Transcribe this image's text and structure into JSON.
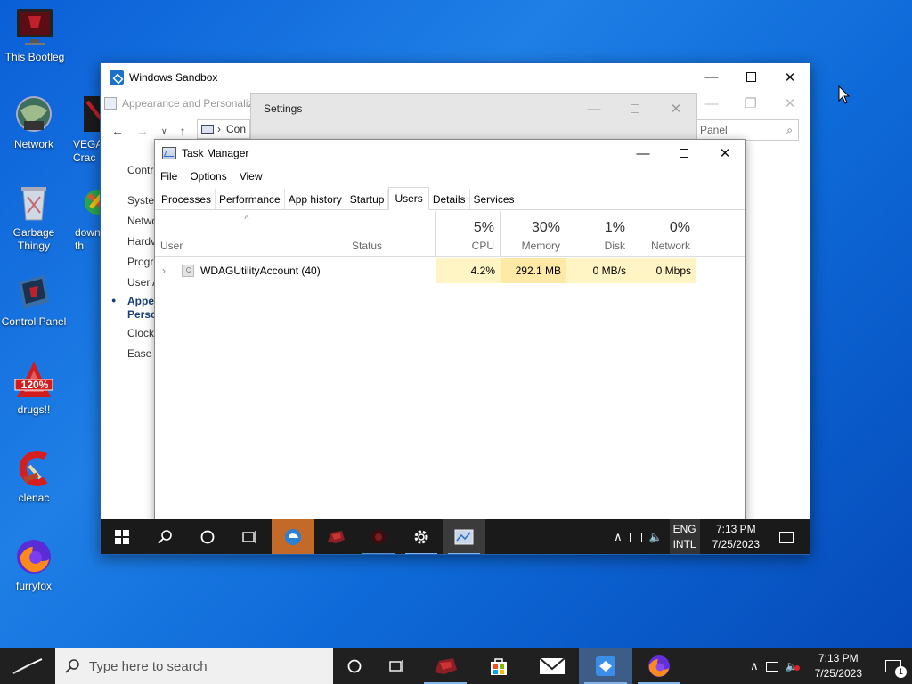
{
  "desktop": {
    "icons": [
      {
        "label": "This Bootleg"
      },
      {
        "label": "Network"
      },
      {
        "label": "VEGA Crac"
      },
      {
        "label": "Garbage Thingy"
      },
      {
        "label": "down th"
      },
      {
        "label": "Control Panel"
      },
      {
        "label": "drugs!!"
      },
      {
        "label": "clenac"
      },
      {
        "label": "furryfox"
      }
    ],
    "badge_120": "120%"
  },
  "sandbox": {
    "title": "Windows Sandbox",
    "control_panel": {
      "title": "Appearance and Personaliza",
      "address": "Con",
      "search_placeholder": "Panel",
      "side_label": "Contr",
      "links": [
        "Syster",
        "Netwo",
        "Hardv",
        "Progr",
        "User A"
      ],
      "active_link": "Appea Perso",
      "links_after": [
        "Clock",
        "Ease c"
      ]
    },
    "settings": {
      "title": "Settings"
    },
    "task_manager": {
      "title": "Task Manager",
      "menu": [
        "File",
        "Options",
        "View"
      ],
      "tabs": [
        "Processes",
        "Performance",
        "App history",
        "Startup",
        "Users",
        "Details",
        "Services"
      ],
      "selected_tab": "Users",
      "columns": {
        "user": "User",
        "status": "Status",
        "cpu": {
          "percent": "5%",
          "label": "CPU"
        },
        "memory": {
          "percent": "30%",
          "label": "Memory"
        },
        "disk": {
          "percent": "1%",
          "label": "Disk"
        },
        "network": {
          "percent": "0%",
          "label": "Network"
        }
      },
      "rows": [
        {
          "name": "WDAGUtilityAccount (40)",
          "status": "",
          "cpu": "4.2%",
          "memory": "292.1 MB",
          "disk": "0 MB/s",
          "network": "0 Mbps"
        }
      ]
    },
    "taskbar": {
      "lang_top": "ENG",
      "lang_bottom": "INTL",
      "time": "7:13 PM",
      "date": "7/25/2023"
    }
  },
  "taskbar": {
    "search_placeholder": "Type here to search",
    "time": "7:13 PM",
    "date": "7/25/2023",
    "notification_count": "1"
  },
  "colors": {
    "desktop": "#0e6ad8",
    "cpu_cell": "#fff4c4",
    "memory_cell": "#ffe9a6",
    "accent": "#1a73c8"
  }
}
